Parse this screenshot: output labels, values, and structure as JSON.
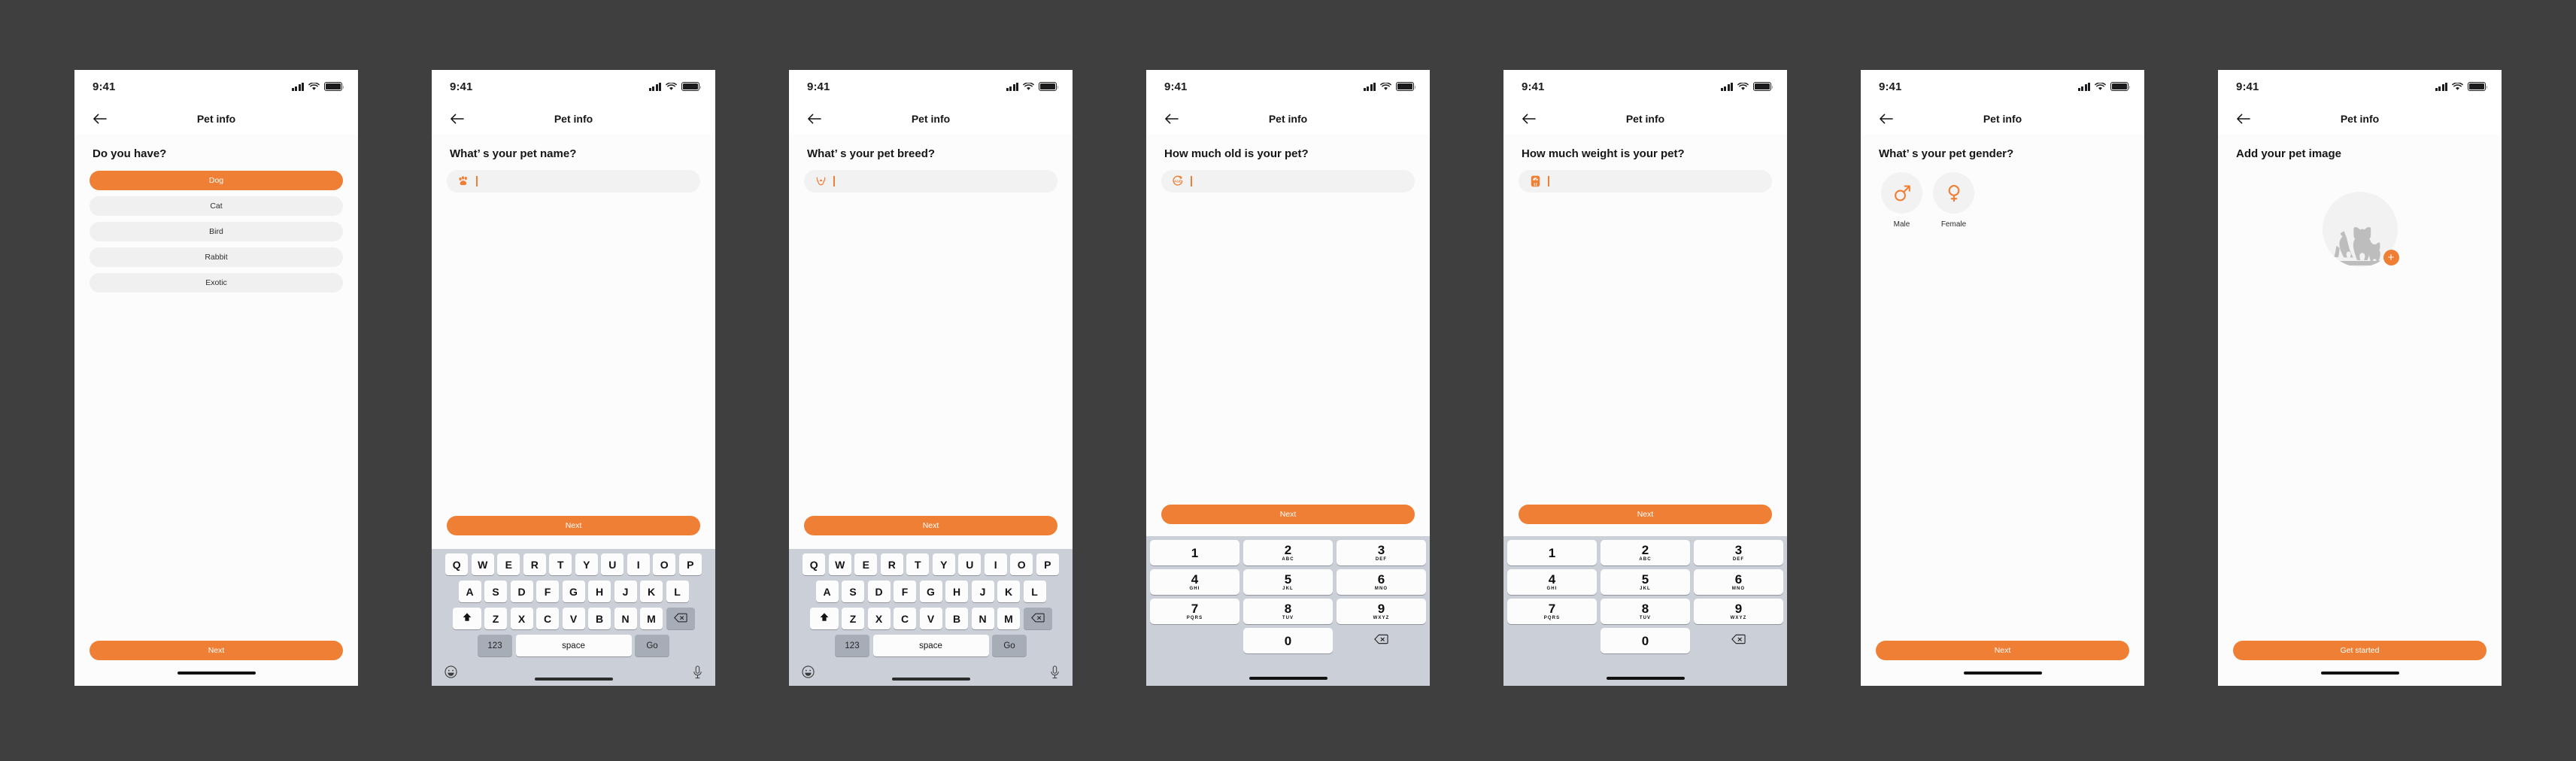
{
  "canvas": {
    "background": "#3f3f3f"
  },
  "theme": {
    "accent": "#ef7f35",
    "chip_bg": "#f0f0f0",
    "screen_bg": "#fcfcfc",
    "keyboard_bg": "#cbd0d8"
  },
  "status_bar": {
    "time": "9:41",
    "signal_icon": "cellular-signal-icon",
    "wifi_icon": "wifi-icon",
    "battery_icon": "battery-icon"
  },
  "nav": {
    "back_icon": "back-arrow-icon",
    "title": "Pet info"
  },
  "screens": [
    {
      "id": "pet-type",
      "question": "Do you have?",
      "options": [
        {
          "label": "Dog",
          "selected": true
        },
        {
          "label": "Cat",
          "selected": false
        },
        {
          "label": "Bird",
          "selected": false
        },
        {
          "label": "Rabbit",
          "selected": false
        },
        {
          "label": "Exotic",
          "selected": false
        }
      ],
      "cta": "Next"
    },
    {
      "id": "pet-name",
      "question": "What’  s your pet name?",
      "input": {
        "value": "",
        "icon": "paw-print-icon"
      },
      "cta": "Next",
      "keyboard": "qwerty"
    },
    {
      "id": "pet-breed",
      "question": "What’  s your pet breed?",
      "input": {
        "value": "",
        "icon": "dog-face-icon"
      },
      "cta": "Next",
      "keyboard": "qwerty"
    },
    {
      "id": "pet-age",
      "question": "How much old is your pet?",
      "input": {
        "value": "",
        "icon": "age-badge-icon"
      },
      "cta": "Next",
      "keyboard": "numeric"
    },
    {
      "id": "pet-weight",
      "question": "How much weight is your pet?",
      "input": {
        "value": "",
        "icon": "weight-scale-icon"
      },
      "cta": "Next",
      "keyboard": "numeric"
    },
    {
      "id": "pet-gender",
      "question": "What’  s your pet gender?",
      "genders": [
        {
          "label": "Male",
          "icon": "mars-symbol-icon"
        },
        {
          "label": "Female",
          "icon": "venus-symbol-icon"
        }
      ],
      "cta": "Next"
    },
    {
      "id": "pet-image",
      "question": "Add your pet image",
      "image_placeholder_icon": "pets-silhouette-icon",
      "add_button_icon": "plus-icon",
      "cta": "Get started"
    }
  ],
  "qwerty": {
    "row1": [
      "Q",
      "W",
      "E",
      "R",
      "T",
      "Y",
      "U",
      "I",
      "O",
      "P"
    ],
    "row2": [
      "A",
      "S",
      "D",
      "F",
      "G",
      "H",
      "J",
      "K",
      "L"
    ],
    "row3": [
      "Z",
      "X",
      "C",
      "V",
      "B",
      "N",
      "M"
    ],
    "shift_icon": "shift-icon",
    "backspace_icon": "backspace-icon",
    "numbers_key": "123",
    "space_key": "space",
    "action_key": "Go",
    "emoji_icon": "emoji-smiley-icon",
    "mic_icon": "microphone-icon"
  },
  "numpad": {
    "keys": [
      {
        "digit": "1",
        "letters": ""
      },
      {
        "digit": "2",
        "letters": "ABC"
      },
      {
        "digit": "3",
        "letters": "DEF"
      },
      {
        "digit": "4",
        "letters": "GHI"
      },
      {
        "digit": "5",
        "letters": "JKL"
      },
      {
        "digit": "6",
        "letters": "MNO"
      },
      {
        "digit": "7",
        "letters": "PQRS"
      },
      {
        "digit": "8",
        "letters": "TUV"
      },
      {
        "digit": "9",
        "letters": "WXYZ"
      },
      {
        "digit": "0",
        "letters": ""
      }
    ],
    "backspace_icon": "backspace-icon"
  }
}
